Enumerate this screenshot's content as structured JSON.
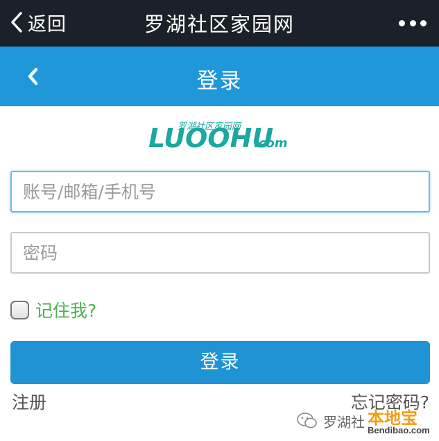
{
  "topbar": {
    "back_label": "返回",
    "title": "罗湖社区家园网"
  },
  "header": {
    "title": "登录"
  },
  "logo": {
    "cn_text": "罗湖社区家园网",
    "en_text": "LUOOHU",
    "en_suffix": ".com",
    "color": "#1aa8a0"
  },
  "form": {
    "account_placeholder": "账号/邮箱/手机号",
    "account_value": "",
    "password_placeholder": "密码",
    "password_value": "",
    "remember_label": "记住我?",
    "remember_checked": false,
    "submit_label": "登录"
  },
  "links": {
    "register": "注册",
    "forgot_password": "忘记密码?"
  },
  "watermark": {
    "wechat_text": "罗湖社",
    "badge": "本地宝",
    "site": "Bendibao.com"
  },
  "colors": {
    "topbar_bg": "#1b2129",
    "header_bg": "#1f97d8",
    "button_bg": "#1f93d3",
    "remember_text": "#4caf50"
  }
}
